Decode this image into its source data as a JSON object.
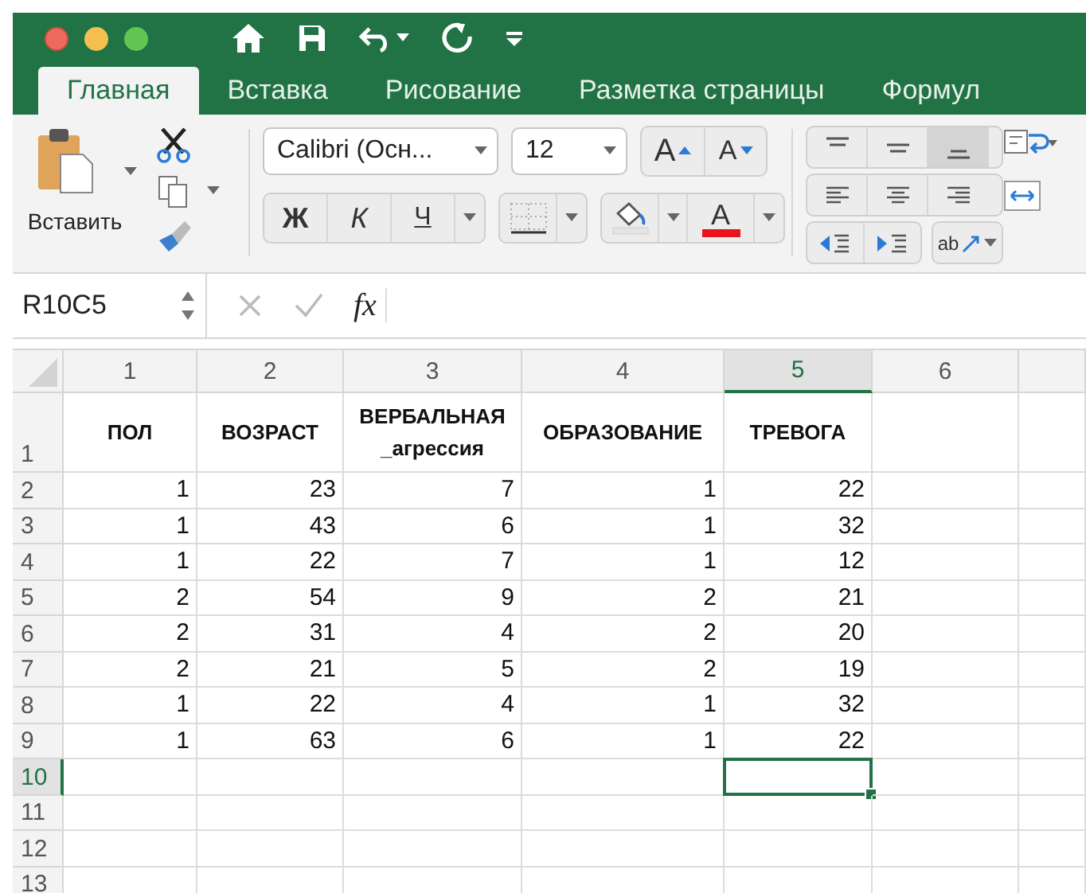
{
  "tabs": [
    {
      "label": "Главная",
      "selected": true
    },
    {
      "label": "Вставка",
      "selected": false
    },
    {
      "label": "Рисование",
      "selected": false
    },
    {
      "label": "Разметка страницы",
      "selected": false
    },
    {
      "label": "Формул",
      "selected": false
    }
  ],
  "ribbon": {
    "paste_label": "Вставить",
    "font_name": "Calibri (Осн...",
    "font_size": "12",
    "grow_font": "A",
    "shrink_font": "A",
    "bold": "Ж",
    "italic": "К",
    "underline": "Ч",
    "font_color": "A",
    "orientation": "ab"
  },
  "formula_bar": {
    "name_box": "R10C5",
    "fx": "fx"
  },
  "sheet": {
    "columns": [
      {
        "label": "1",
        "selected": false
      },
      {
        "label": "2",
        "selected": false
      },
      {
        "label": "3",
        "selected": false
      },
      {
        "label": "4",
        "selected": false
      },
      {
        "label": "5",
        "selected": true
      },
      {
        "label": "6",
        "selected": false
      }
    ],
    "rows": [
      {
        "number": "1",
        "selected": false,
        "kind": "header",
        "cells": [
          "ПОЛ",
          "ВОЗРАСТ",
          "ВЕРБАЛЬНАЯ _агрессия",
          "ОБРАЗОВАНИЕ",
          "ТРЕВОГА"
        ]
      },
      {
        "number": "2",
        "selected": false,
        "kind": "data",
        "cells": [
          "1",
          "23",
          "7",
          "1",
          "22"
        ]
      },
      {
        "number": "3",
        "selected": false,
        "kind": "data",
        "cells": [
          "1",
          "43",
          "6",
          "1",
          "32"
        ]
      },
      {
        "number": "4",
        "selected": false,
        "kind": "data",
        "cells": [
          "1",
          "22",
          "7",
          "1",
          "12"
        ]
      },
      {
        "number": "5",
        "selected": false,
        "kind": "data",
        "cells": [
          "2",
          "54",
          "9",
          "2",
          "21"
        ]
      },
      {
        "number": "6",
        "selected": false,
        "kind": "data",
        "cells": [
          "2",
          "31",
          "4",
          "2",
          "20"
        ]
      },
      {
        "number": "7",
        "selected": false,
        "kind": "data",
        "cells": [
          "2",
          "21",
          "5",
          "2",
          "19"
        ]
      },
      {
        "number": "8",
        "selected": false,
        "kind": "data",
        "cells": [
          "1",
          "22",
          "4",
          "1",
          "32"
        ]
      },
      {
        "number": "9",
        "selected": false,
        "kind": "data",
        "cells": [
          "1",
          "63",
          "6",
          "1",
          "22"
        ]
      },
      {
        "number": "10",
        "selected": true,
        "kind": "data",
        "cells": []
      },
      {
        "number": "11",
        "selected": false,
        "kind": "data",
        "cells": []
      },
      {
        "number": "12",
        "selected": false,
        "kind": "data",
        "cells": []
      },
      {
        "number": "13",
        "selected": false,
        "kind": "data",
        "cells": []
      }
    ]
  }
}
